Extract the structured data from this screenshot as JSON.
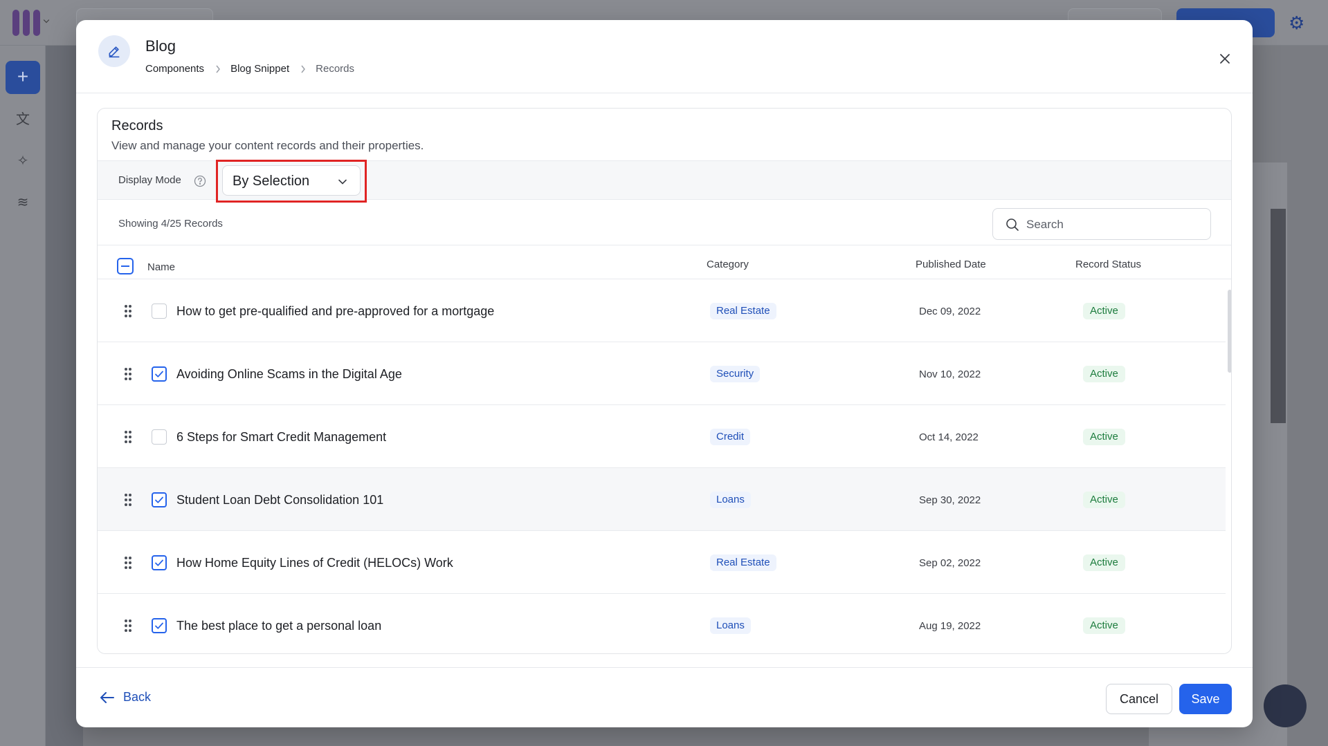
{
  "modal": {
    "title": "Blog",
    "breadcrumb": [
      "Components",
      "Blog Snippet",
      "Records"
    ]
  },
  "records": {
    "title": "Records",
    "description": "View and manage your content records and their properties.",
    "display_mode_label": "Display Mode",
    "display_mode_value": "By Selection",
    "showing_text": "Showing 4/25 Records",
    "search_placeholder": "Search",
    "columns": [
      "Name",
      "Category",
      "Published Date",
      "Record Status"
    ],
    "rows": [
      {
        "name": "How to get pre-qualified and pre-approved for a mortgage",
        "category": "Real Estate",
        "date": "Dec 09, 2022",
        "status": "Active",
        "checked": false
      },
      {
        "name": "Avoiding Online Scams in the Digital Age",
        "category": "Security",
        "date": "Nov 10, 2022",
        "status": "Active",
        "checked": true
      },
      {
        "name": "6 Steps for Smart Credit Management",
        "category": "Credit",
        "date": "Oct 14, 2022",
        "status": "Active",
        "checked": false
      },
      {
        "name": "Student Loan Debt Consolidation 101",
        "category": "Loans",
        "date": "Sep 30, 2022",
        "status": "Active",
        "checked": true
      },
      {
        "name": "How Home Equity Lines of Credit (HELOCs) Work",
        "category": "Real Estate",
        "date": "Sep 02, 2022",
        "status": "Active",
        "checked": true
      },
      {
        "name": "The best place to get a personal loan",
        "category": "Loans",
        "date": "Aug 19, 2022",
        "status": "Active",
        "checked": true
      }
    ]
  },
  "footer": {
    "back_label": "Back",
    "cancel_label": "Cancel",
    "save_label": "Save"
  },
  "icons": {
    "header": "pencil-icon",
    "close": "close-icon",
    "help": "help-circle-icon",
    "dropdown": "chevron-down-icon",
    "search": "search-icon",
    "drag": "drag-handle-icon",
    "check": "check-icon",
    "back": "arrow-left-icon"
  },
  "colors": {
    "accent": "#2563eb",
    "highlight": "#e02424",
    "status_active": "#1c7c3d",
    "category": "#1f4fb8"
  }
}
